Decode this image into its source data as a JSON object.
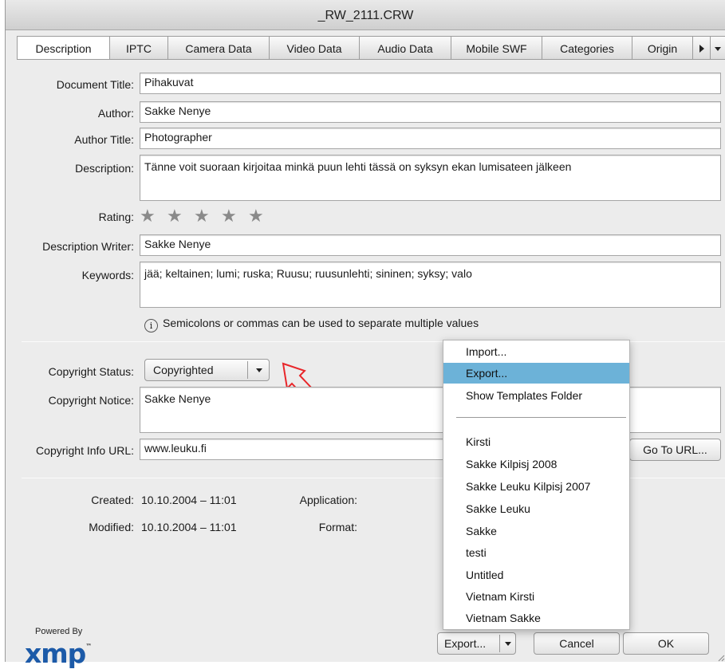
{
  "window": {
    "title": "_RW_2111.CRW"
  },
  "tabs": [
    {
      "label": "Description",
      "active": true
    },
    {
      "label": "IPTC"
    },
    {
      "label": "Camera Data"
    },
    {
      "label": "Video Data"
    },
    {
      "label": "Audio Data"
    },
    {
      "label": "Mobile SWF"
    },
    {
      "label": "Categories"
    },
    {
      "label": "Origin"
    }
  ],
  "fields": {
    "document_title": {
      "label": "Document Title:",
      "value": "Pihakuvat"
    },
    "author": {
      "label": "Author:",
      "value": "Sakke Nenye"
    },
    "author_title": {
      "label": "Author Title:",
      "value": "Photographer"
    },
    "description": {
      "label": "Description:",
      "value": "Tänne voit suoraan kirjoitaa minkä puun lehti tässä on syksyn ekan lumisateen jälkeen"
    },
    "rating": {
      "label": "Rating:",
      "stars_filled": 0,
      "stars_total": 5
    },
    "description_writer": {
      "label": "Description Writer:",
      "value": "Sakke Nenye"
    },
    "keywords": {
      "label": "Keywords:",
      "value": "jää; keltainen; lumi; ruska; Ruusu; ruusunlehti; sininen; syksy; valo"
    },
    "hint": "Semicolons or commas can be used to separate multiple values"
  },
  "copyright": {
    "status_label": "Copyright Status:",
    "status_value": "Copyrighted",
    "notice_label": "Copyright Notice:",
    "notice_value": "Sakke Nenye",
    "url_label": "Copyright Info URL:",
    "url_value": "www.leuku.fi",
    "go_to_url": "Go To URL..."
  },
  "meta": {
    "created_label": "Created:",
    "created_value": "10.10.2004 – 11:01",
    "modified_label": "Modified:",
    "modified_value": "10.10.2004 – 11:01",
    "application_label": "Application:",
    "format_label": "Format:"
  },
  "templates_menu": {
    "items_top": [
      "Import...",
      "Export...",
      "Show Templates Folder"
    ],
    "highlighted": "Export...",
    "templates": [
      "Kirsti",
      "Sakke Kilpisj 2008",
      "Sakke Leuku Kilpisj 2007",
      "Sakke Leuku",
      "Sakke",
      "testi",
      "Untitled",
      "Vietnam Kirsti",
      "Vietnam Sakke"
    ]
  },
  "footer": {
    "export_button": "Export...",
    "cancel_button": "Cancel",
    "ok_button": "OK",
    "powered_by": "Powered By",
    "logo_text": "xmp",
    "logo_tm": "™"
  },
  "colors": {
    "menu_highlight": "#6cb2d8",
    "annotation_arrow": "#e8262a",
    "xmp_logo": "#1c5aa8"
  }
}
